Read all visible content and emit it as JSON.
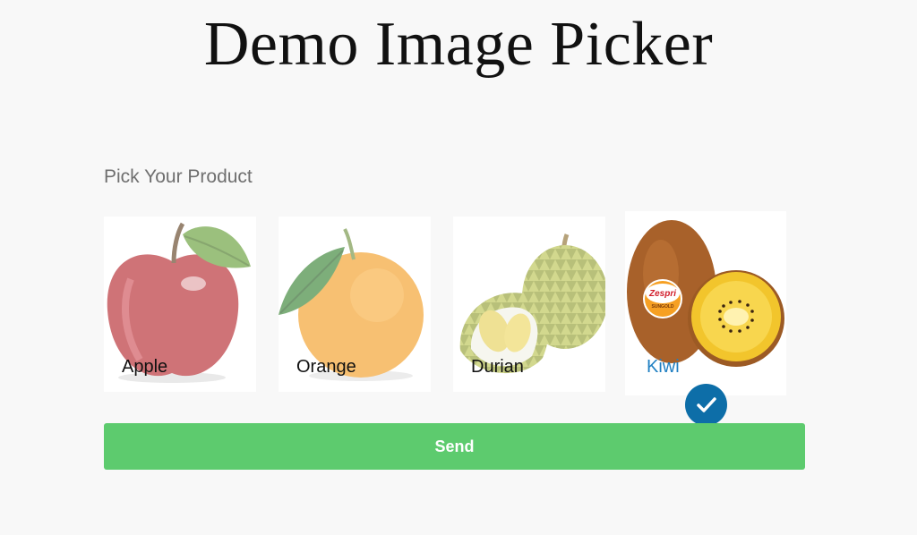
{
  "page": {
    "title": "Demo Image Picker"
  },
  "picker": {
    "prompt": "Pick Your Product",
    "options": [
      {
        "label": "Apple",
        "selected": false
      },
      {
        "label": "Orange",
        "selected": false
      },
      {
        "label": "Durian",
        "selected": false
      },
      {
        "label": "Kiwi",
        "selected": true
      }
    ],
    "kiwi_sticker_brand": "Zespri",
    "kiwi_sticker_sub": "SUNGOLD"
  },
  "actions": {
    "send_label": "Send"
  },
  "colors": {
    "background": "#f8f8f8",
    "send_button": "#5dcb6e",
    "check_badge": "#0d6ea8",
    "selected_label": "#1f7fc2"
  },
  "icons": {
    "selected_badge": "checkmark-icon"
  }
}
